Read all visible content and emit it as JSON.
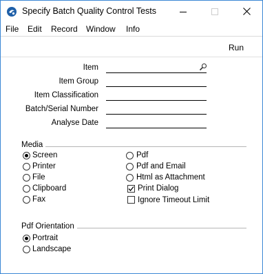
{
  "window": {
    "title": "Specify Batch Quality Control Tests"
  },
  "menu": {
    "items": [
      "File",
      "Edit",
      "Record",
      "Window",
      "Info"
    ]
  },
  "toolbar": {
    "run_label": "Run"
  },
  "fields": [
    {
      "label": "Item",
      "value": ""
    },
    {
      "label": "Item Group",
      "value": ""
    },
    {
      "label": "Item Classification",
      "value": ""
    },
    {
      "label": "Batch/Serial Number",
      "value": ""
    },
    {
      "label": "Analyse Date",
      "value": ""
    }
  ],
  "media": {
    "title": "Media",
    "selected": "Screen",
    "left_options": [
      "Screen",
      "Printer",
      "File",
      "Clipboard",
      "Fax"
    ],
    "right_options": [
      "Pdf",
      "Pdf and Email",
      "Html as Attachment"
    ],
    "checkboxes": [
      {
        "label": "Print Dialog",
        "checked": true
      },
      {
        "label": "Ignore Timeout Limit",
        "checked": false
      }
    ]
  },
  "pdf_orientation": {
    "title": "Pdf Orientation",
    "selected": "Portrait",
    "options": [
      "Portrait",
      "Landscape"
    ]
  },
  "colors": {
    "window_border": "#3a86d4",
    "app_icon": "#1e5fa8"
  }
}
